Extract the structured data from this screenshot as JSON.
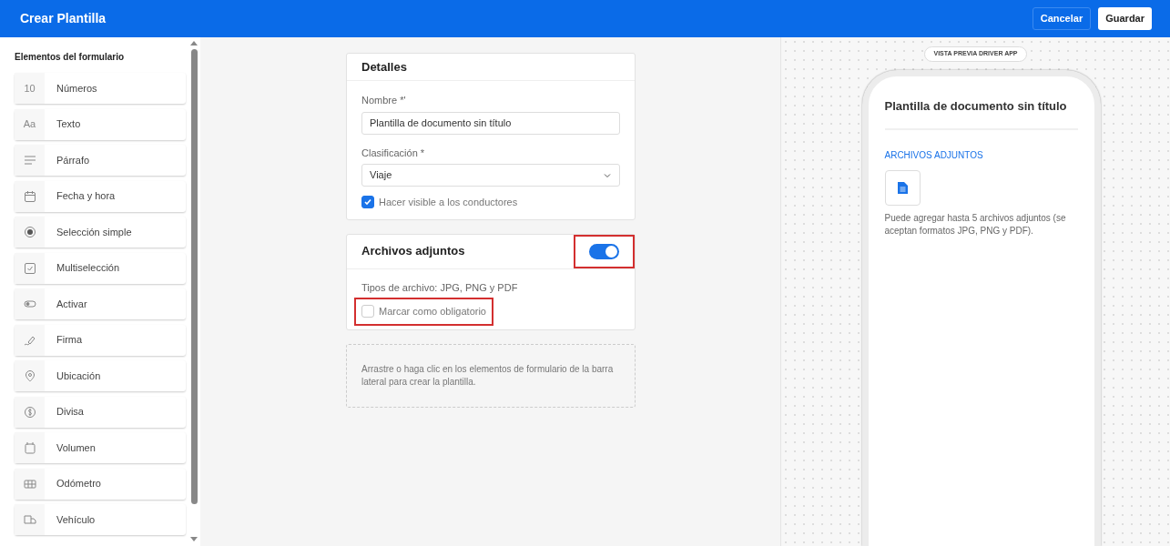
{
  "header": {
    "title": "Crear Plantilla",
    "buttons": [
      {
        "label": "Cancelar",
        "kind": "outline"
      },
      {
        "label": "Guardar",
        "kind": "solid"
      }
    ]
  },
  "sidebar": {
    "title": "Elementos del formulario",
    "items": [
      {
        "label": "Números",
        "kind": "number",
        "icon_text": "10"
      },
      {
        "label": "Texto",
        "kind": "text",
        "icon_text": "Aa"
      },
      {
        "label": "Párrafo",
        "kind": "paragraph"
      },
      {
        "label": "Fecha y hora",
        "kind": "calendar"
      },
      {
        "label": "Selección simple",
        "kind": "radio"
      },
      {
        "label": "Multiselección",
        "kind": "checkbox"
      },
      {
        "label": "Activar",
        "kind": "toggle"
      },
      {
        "label": "Firma",
        "kind": "signature"
      },
      {
        "label": "Ubicación",
        "kind": "location"
      },
      {
        "label": "Divisa",
        "kind": "currency"
      },
      {
        "label": "Volumen",
        "kind": "volume"
      },
      {
        "label": "Odómetro",
        "kind": "odometer"
      },
      {
        "label": "Vehículo",
        "kind": "vehicle"
      }
    ]
  },
  "details": {
    "title": "Detalles",
    "name_label": "Nombre *'",
    "name_value": "Plantilla de documento sin título",
    "class_label": "Clasificación *",
    "class_value": "Viaje",
    "visible": {
      "label": "Hacer visible a los conductores",
      "checked": true
    }
  },
  "attachments": {
    "title": "Archivos adjuntos",
    "on": true,
    "toggle_highlighted": true,
    "types": "Tipos de archivo: JPG, PNG y PDF",
    "required": {
      "label": "Marcar como obligatorio",
      "checked": false,
      "highlighted": true
    }
  },
  "dropzone": {
    "text": "Arrastre o haga clic en los elementos de formulario de la barra lateral para crear la plantilla."
  },
  "preview": {
    "badge": "VISTA PREVIA DRIVER APP",
    "title": "Plantilla de documento sin título",
    "section": "ARCHIVOS ADJUNTOS",
    "note": "Puede agregar hasta 5 archivos adjuntos (se aceptan formatos JPG, PNG y PDF)."
  }
}
